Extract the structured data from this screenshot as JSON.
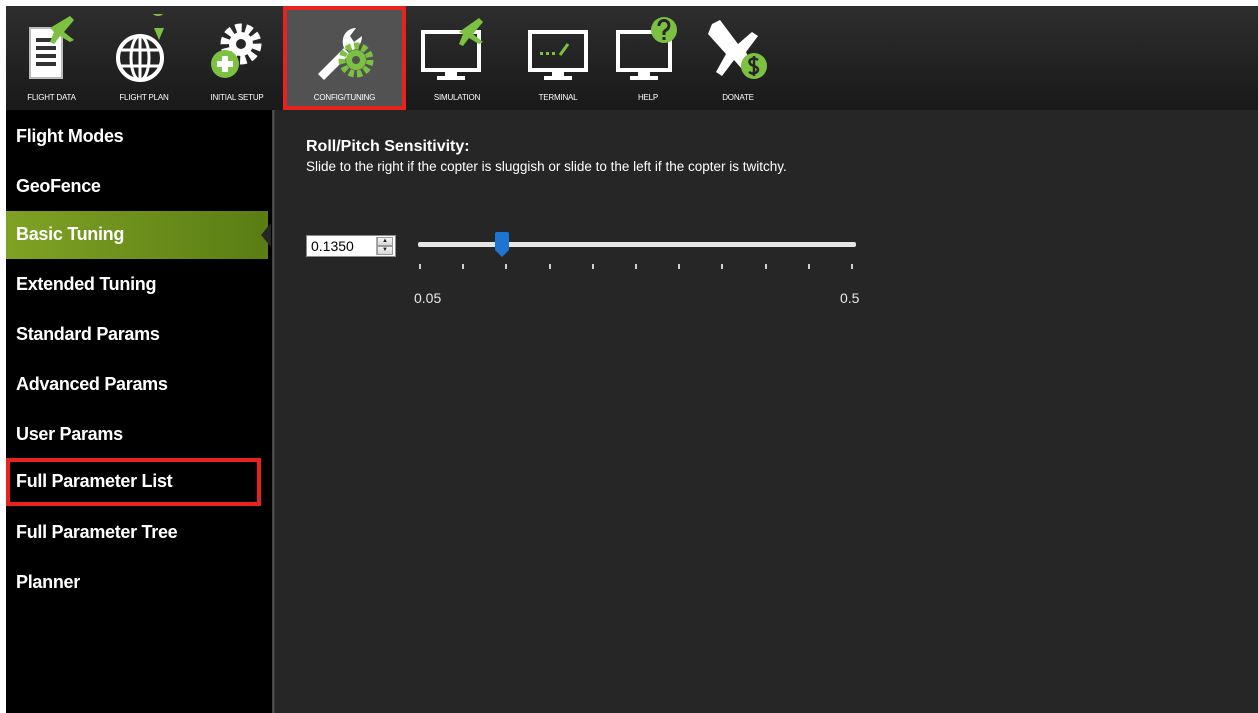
{
  "toolbar": {
    "items": [
      {
        "label": "FLIGHT DATA",
        "icon": "flight-data-icon"
      },
      {
        "label": "FLIGHT PLAN",
        "icon": "flight-plan-icon"
      },
      {
        "label": "INITIAL SETUP",
        "icon": "initial-setup-icon"
      },
      {
        "label": "CONFIG/TUNING",
        "icon": "config-tuning-icon",
        "active": true
      },
      {
        "label": "SIMULATION",
        "icon": "simulation-icon"
      },
      {
        "label": "TERMINAL",
        "icon": "terminal-icon"
      },
      {
        "label": "HELP",
        "icon": "help-icon"
      },
      {
        "label": "DONATE",
        "icon": "donate-icon"
      }
    ]
  },
  "sidebar": {
    "items": [
      {
        "label": "Flight Modes"
      },
      {
        "label": "GeoFence"
      },
      {
        "label": "Basic Tuning",
        "active": true
      },
      {
        "label": "Extended Tuning"
      },
      {
        "label": "Standard Params"
      },
      {
        "label": "Advanced Params"
      },
      {
        "label": "User Params"
      },
      {
        "label": "Full Parameter List",
        "highlighted": true
      },
      {
        "label": "Full Parameter Tree"
      },
      {
        "label": "Planner"
      }
    ]
  },
  "main": {
    "title": "Roll/Pitch Sensitivity:",
    "description": "Slide to the right if the copter is sluggish or slide to the left if the copter is twitchy.",
    "value": "0.1350",
    "slider": {
      "min": 0.05,
      "max": 0.5,
      "value": 0.135,
      "min_label": "0.05",
      "max_label": "0.5"
    }
  },
  "colors": {
    "accent_green": "#7fa224",
    "highlight_red": "#e6231e",
    "slider_thumb": "#1e74d2",
    "icon_green": "#7cc142"
  }
}
